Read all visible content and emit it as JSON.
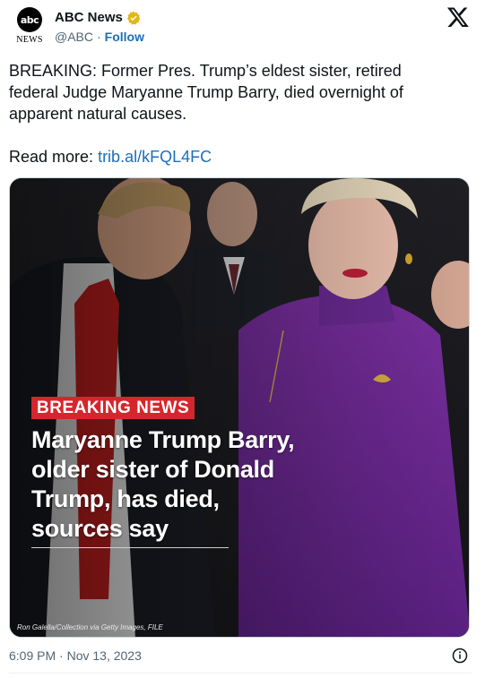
{
  "account": {
    "name": "ABC News",
    "handle": "@ABC",
    "separator": "·",
    "follow_label": "Follow",
    "avatar_text": "abc",
    "avatar_subtext": "NEWS",
    "verified": true
  },
  "tweet": {
    "text_lines": [
      "BREAKING: Former Pres. Trump’s eldest sister, retired",
      "federal Judge Maryanne Trump Barry, died overnight of",
      "apparent natural causes."
    ],
    "read_more_label": "Read more:",
    "link_text": "trib.al/kFQL4FC"
  },
  "media": {
    "breaking_label": "BREAKING NEWS",
    "headline_lines": [
      "Maryanne Trump Barry,",
      "older sister of Donald",
      "Trump, has died,",
      "sources say"
    ],
    "photo_credit": "Ron Galella/Collection via Getty Images, FILE"
  },
  "footer": {
    "timestamp": "6:09 PM · Nov 13, 2023"
  },
  "icons": {
    "platform": "x-logo-icon",
    "verified": "verified-badge-icon",
    "info": "info-icon"
  },
  "colors": {
    "link": "#1d6fb8",
    "verified_gold": "#e2b719",
    "breaking_red": "#d6262d",
    "muted": "#536471"
  }
}
